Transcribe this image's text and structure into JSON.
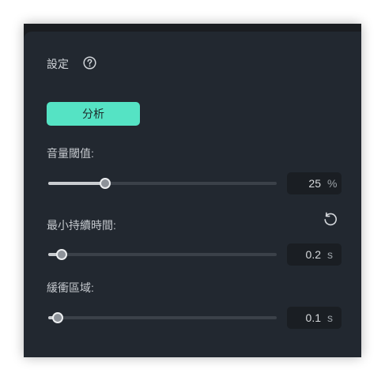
{
  "panel": {
    "title": "設定",
    "help_icon": "question-circle-icon"
  },
  "analyze_button": {
    "label": "分析",
    "color": "#55e3c4"
  },
  "volume_threshold": {
    "label": "音量閾值:",
    "value": "25",
    "unit": "%",
    "level": 0.25
  },
  "min_duration": {
    "label": "最小持續時間:",
    "value": "0.2",
    "unit": "s",
    "level": 0.06,
    "reset_icon": "reset-icon"
  },
  "buffer_zone": {
    "label": "緩衝區域:",
    "value": "0.1",
    "unit": "s",
    "level": 0.04
  }
}
